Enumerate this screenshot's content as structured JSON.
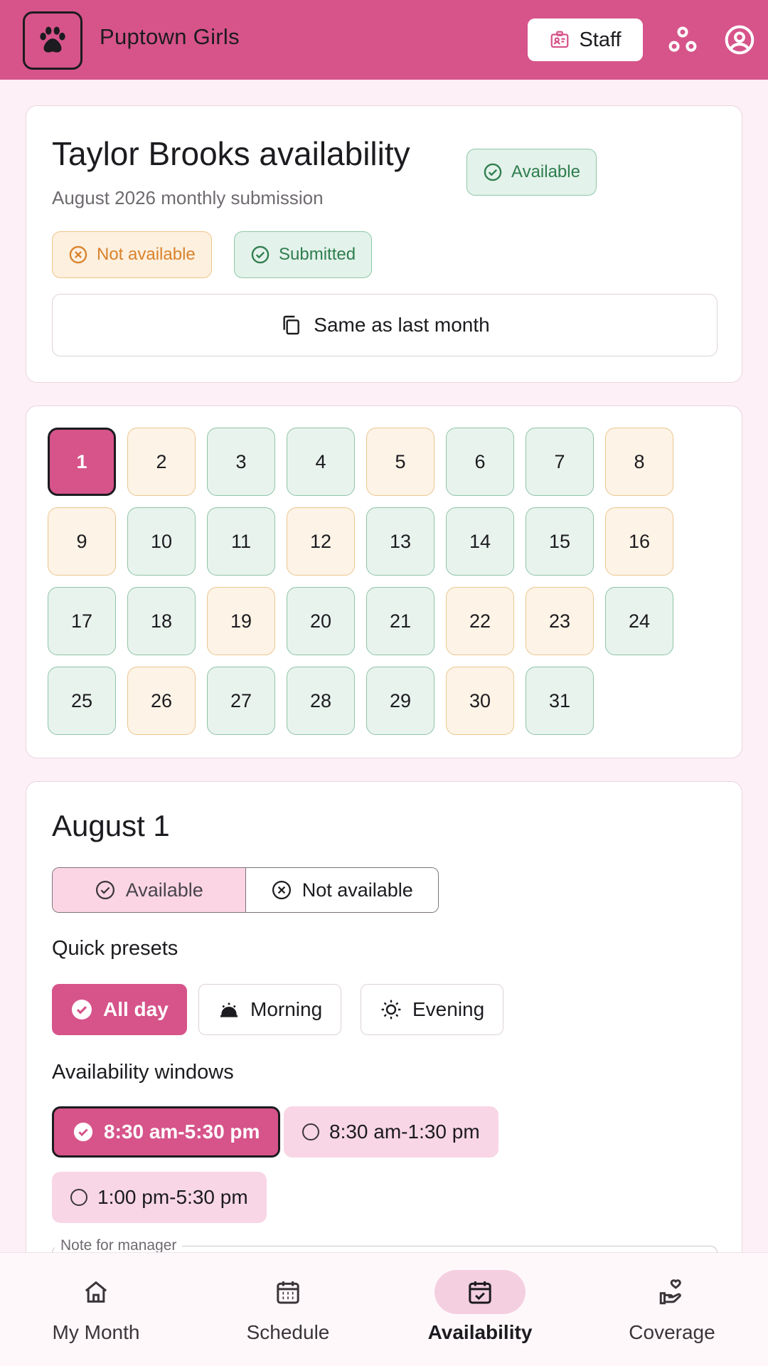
{
  "app": {
    "title": "Puptown Girls",
    "staff_label": "Staff",
    "brand_color": "#d6548a"
  },
  "header_icons": [
    "paw-icon",
    "badge-icon",
    "org-icon",
    "account-icon"
  ],
  "profile": {
    "title": "Taylor Brooks availability",
    "subtitle": "August 2026 monthly submission",
    "status_available": "Available",
    "status_not_available": "Not available",
    "status_submitted": "Submitted",
    "same_as_last_month": "Same as last month"
  },
  "calendar": {
    "selected_day": "1",
    "days": [
      {
        "d": "1",
        "s": "sel"
      },
      {
        "d": "2",
        "s": "n"
      },
      {
        "d": "3",
        "s": "a"
      },
      {
        "d": "4",
        "s": "a"
      },
      {
        "d": "5",
        "s": "n"
      },
      {
        "d": "6",
        "s": "a"
      },
      {
        "d": "7",
        "s": "a"
      },
      {
        "d": "8",
        "s": "n"
      },
      {
        "d": "9",
        "s": "n"
      },
      {
        "d": "10",
        "s": "a"
      },
      {
        "d": "11",
        "s": "a"
      },
      {
        "d": "12",
        "s": "n"
      },
      {
        "d": "13",
        "s": "a"
      },
      {
        "d": "14",
        "s": "a"
      },
      {
        "d": "15",
        "s": "a"
      },
      {
        "d": "16",
        "s": "n"
      },
      {
        "d": "17",
        "s": "a"
      },
      {
        "d": "18",
        "s": "a"
      },
      {
        "d": "19",
        "s": "n"
      },
      {
        "d": "20",
        "s": "a"
      },
      {
        "d": "21",
        "s": "a"
      },
      {
        "d": "22",
        "s": "n"
      },
      {
        "d": "23",
        "s": "n"
      },
      {
        "d": "24",
        "s": "a"
      },
      {
        "d": "25",
        "s": "a"
      },
      {
        "d": "26",
        "s": "n"
      },
      {
        "d": "27",
        "s": "a"
      },
      {
        "d": "28",
        "s": "a"
      },
      {
        "d": "29",
        "s": "a"
      },
      {
        "d": "30",
        "s": "n"
      },
      {
        "d": "31",
        "s": "a"
      }
    ]
  },
  "detail": {
    "date_title": "August 1",
    "toggle_available": "Available",
    "toggle_not_available": "Not available",
    "quick_presets_label": "Quick presets",
    "presets": {
      "all_day": "All day",
      "morning": "Morning",
      "evening": "Evening"
    },
    "windows_label": "Availability windows",
    "windows": {
      "w1": "8:30 am-5:30 pm",
      "w2": "8:30 am-1:30 pm",
      "w3": "1:00 pm-5:30 pm"
    },
    "note_label": "Note for manager"
  },
  "nav": {
    "my_month": "My Month",
    "schedule": "Schedule",
    "availability": "Availability",
    "coverage": "Coverage",
    "active": "Availability"
  }
}
